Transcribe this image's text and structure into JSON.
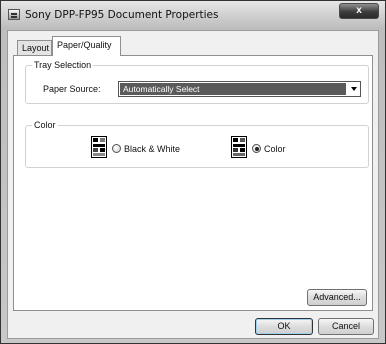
{
  "window": {
    "title": "Sony DPP-FP95 Document Properties",
    "close_label": "x"
  },
  "tabs": [
    {
      "label": "Layout"
    },
    {
      "label": "Paper/Quality"
    }
  ],
  "tray": {
    "group_label": "Tray Selection",
    "source_label": "Paper Source:",
    "source_value": "Automatically Select"
  },
  "color": {
    "group_label": "Color",
    "options": [
      {
        "label": "Black & White",
        "selected": false
      },
      {
        "label": "Color",
        "selected": true
      }
    ]
  },
  "buttons": {
    "advanced": "Advanced...",
    "ok": "OK",
    "cancel": "Cancel"
  }
}
